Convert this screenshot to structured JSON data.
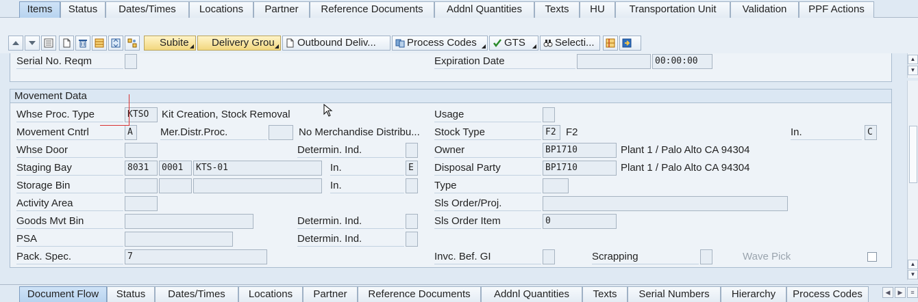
{
  "top_tabs": [
    {
      "label": "Items",
      "active": true
    },
    {
      "label": "Status"
    },
    {
      "label": "Dates/Times"
    },
    {
      "label": "Locations"
    },
    {
      "label": "Partner"
    },
    {
      "label": "Reference Documents"
    },
    {
      "label": "Addnl Quantities"
    },
    {
      "label": "Texts"
    },
    {
      "label": "HU"
    },
    {
      "label": "Transportation Unit"
    },
    {
      "label": "Validation"
    },
    {
      "label": "PPF Actions"
    }
  ],
  "toolbar": {
    "subitem": "Subite",
    "delivery_group": "Delivery Grou",
    "outbound_delivery": "Outbound Deliv...",
    "process_codes": "Process Codes",
    "gts": "GTS",
    "selection": "Selecti..."
  },
  "upper": {
    "serial_no_reqm_label": "Serial No. Reqm",
    "expiration_date_label": "Expiration Date",
    "expiration_date_value": "",
    "expiration_time_value": "00:00:00"
  },
  "movement": {
    "title": "Movement Data",
    "whse_proc_type_label": "Whse Proc. Type",
    "whse_proc_type_value": "KTSO",
    "whse_proc_type_desc": "Kit Creation, Stock Removal",
    "movement_cntrl_label": "Movement Cntrl",
    "movement_cntrl_value": "A",
    "mer_distr_label": "Mer.Distr.Proc.",
    "mer_distr_desc": "No Merchandise Distribu...",
    "whse_door_label": "Whse Door",
    "determin_ind_label": "Determin. Ind.",
    "staging_bay_label": "Staging Bay",
    "staging_bay_1": "8031",
    "staging_bay_2": "0001",
    "staging_bay_3": "KTS-01",
    "in_label": "In.",
    "staging_in_value": "E",
    "storage_bin_label": "Storage Bin",
    "activity_area_label": "Activity Area",
    "goods_mvt_bin_label": "Goods Mvt Bin",
    "psa_label": "PSA",
    "pack_spec_label": "Pack. Spec.",
    "pack_spec_value": "7",
    "usage_label": "Usage",
    "stock_type_label": "Stock Type",
    "stock_type_value": "F2",
    "stock_type_desc": "F2",
    "stock_in_value": "C",
    "owner_label": "Owner",
    "owner_value": "BP1710",
    "owner_desc": "Plant 1 / Palo Alto CA 94304",
    "disposal_party_label": "Disposal Party",
    "disposal_party_value": "BP1710",
    "disposal_party_desc": "Plant 1 / Palo Alto CA 94304",
    "type_label": "Type",
    "sls_order_proj_label": "Sls Order/Proj.",
    "sls_order_item_label": "Sls Order Item",
    "sls_order_item_value": "0",
    "invc_bef_gi_label": "Invc. Bef. GI",
    "scrapping_label": "Scrapping",
    "wave_pick_label": "Wave Pick"
  },
  "bottom_tabs": [
    {
      "label": "Document Flow",
      "active": true
    },
    {
      "label": "Status"
    },
    {
      "label": "Dates/Times"
    },
    {
      "label": "Locations"
    },
    {
      "label": "Partner"
    },
    {
      "label": "Reference Documents"
    },
    {
      "label": "Addnl Quantities"
    },
    {
      "label": "Texts"
    },
    {
      "label": "Serial Numbers"
    },
    {
      "label": "Hierarchy"
    },
    {
      "label": "Process Codes"
    }
  ]
}
